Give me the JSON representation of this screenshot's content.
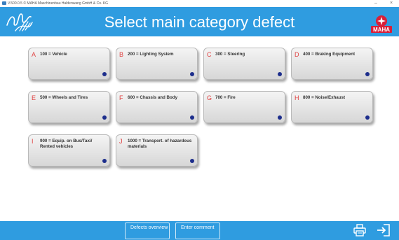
{
  "window": {
    "title": "V.500.0.5 © MAHA Maschinenbau Haldenwang GmbH & Co. KG",
    "minimize_glyph": "–",
    "close_glyph": "×"
  },
  "header": {
    "title": "Select main category defect",
    "hand_icon": "hand-signature-icon",
    "logo_text": "MAHA",
    "brand_color": "#2f9ce0"
  },
  "categories": [
    {
      "letter": "A",
      "label": "100 = Vehicle"
    },
    {
      "letter": "B",
      "label": "200 = Lighting System"
    },
    {
      "letter": "C",
      "label": "300 = Steering"
    },
    {
      "letter": "D",
      "label": "400 = Braking Equipment"
    },
    {
      "letter": "E",
      "label": "500 = Wheels and Tires"
    },
    {
      "letter": "F",
      "label": "600 = Chassis and Body"
    },
    {
      "letter": "G",
      "label": "700 = Fire"
    },
    {
      "letter": "H",
      "label": "800 = Noise/Exhaust"
    },
    {
      "letter": "I",
      "label": "900 = Equip. on Bus/Taxi/ Rented vehicles"
    },
    {
      "letter": "J",
      "label": "1000 = Transport. of hazardous materials"
    }
  ],
  "footer": {
    "defects_overview": "Defects overview",
    "enter_comment": "Enter comment",
    "print_icon": "printer-icon",
    "exit_icon": "exit-door-icon"
  },
  "colors": {
    "letter": "#e04040",
    "dot": "#1d2e8c"
  }
}
